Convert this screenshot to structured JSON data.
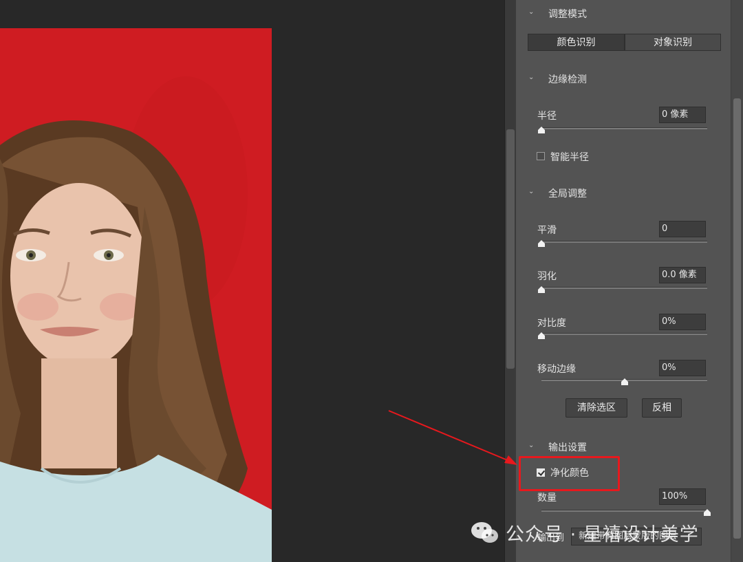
{
  "panel": {
    "sections": {
      "mode": "调整模式",
      "edge": "边缘检测",
      "global": "全局调整",
      "output": "输出设置"
    },
    "mode_tabs": [
      "颜色识别",
      "对象识别"
    ],
    "radius": {
      "label": "半径",
      "value": "0 像素",
      "level": 0
    },
    "smart_radius": {
      "label": "智能半径",
      "checked": false
    },
    "smooth": {
      "label": "平滑",
      "value": "0",
      "level": 0
    },
    "feather": {
      "label": "羽化",
      "value": "0.0 像素",
      "level": 0
    },
    "contrast": {
      "label": "对比度",
      "value": "0%",
      "level": 0
    },
    "shift_edge": {
      "label": "移动边缘",
      "value": "0%",
      "level": 0.5
    },
    "buttons": {
      "clear": "清除选区",
      "invert": "反相"
    },
    "decontaminate": {
      "label": "净化颜色",
      "checked": true
    },
    "amount": {
      "label": "数量",
      "value": "100%",
      "level": 1
    },
    "output_to": {
      "label": "输出到",
      "value": "新建带有图层蒙版的图层"
    }
  },
  "watermark": {
    "text": "公众号 · 星禧设计美学"
  },
  "colors": {
    "background_red": "#cf1c22",
    "highlight": "#e8181d",
    "panel": "#535353"
  }
}
